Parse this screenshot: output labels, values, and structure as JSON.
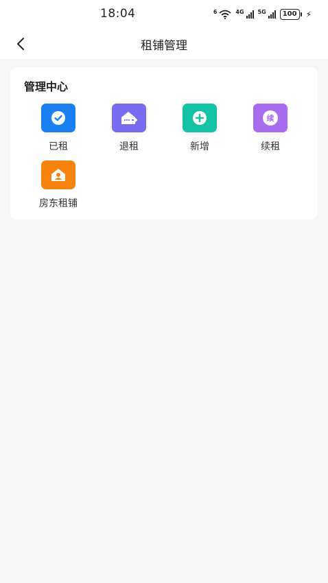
{
  "status_bar": {
    "time": "18:04",
    "wifi_label": "6",
    "network_1": "4G",
    "network_2": "5G",
    "battery": "100"
  },
  "nav": {
    "title": "租铺管理"
  },
  "management": {
    "title": "管理中心",
    "items": [
      {
        "label": "已租",
        "icon": "check-circle-icon",
        "color": "#1a7ff0"
      },
      {
        "label": "退租",
        "icon": "house-return-icon",
        "color": "#7a6cf0"
      },
      {
        "label": "新增",
        "icon": "plus-circle-icon",
        "color": "#14c3a6"
      },
      {
        "label": "续租",
        "icon": "renew-icon",
        "color": "#a86cf0",
        "glyph": "续"
      },
      {
        "label": "房东租铺",
        "icon": "landlord-house-icon",
        "color": "#f7830f"
      }
    ]
  }
}
